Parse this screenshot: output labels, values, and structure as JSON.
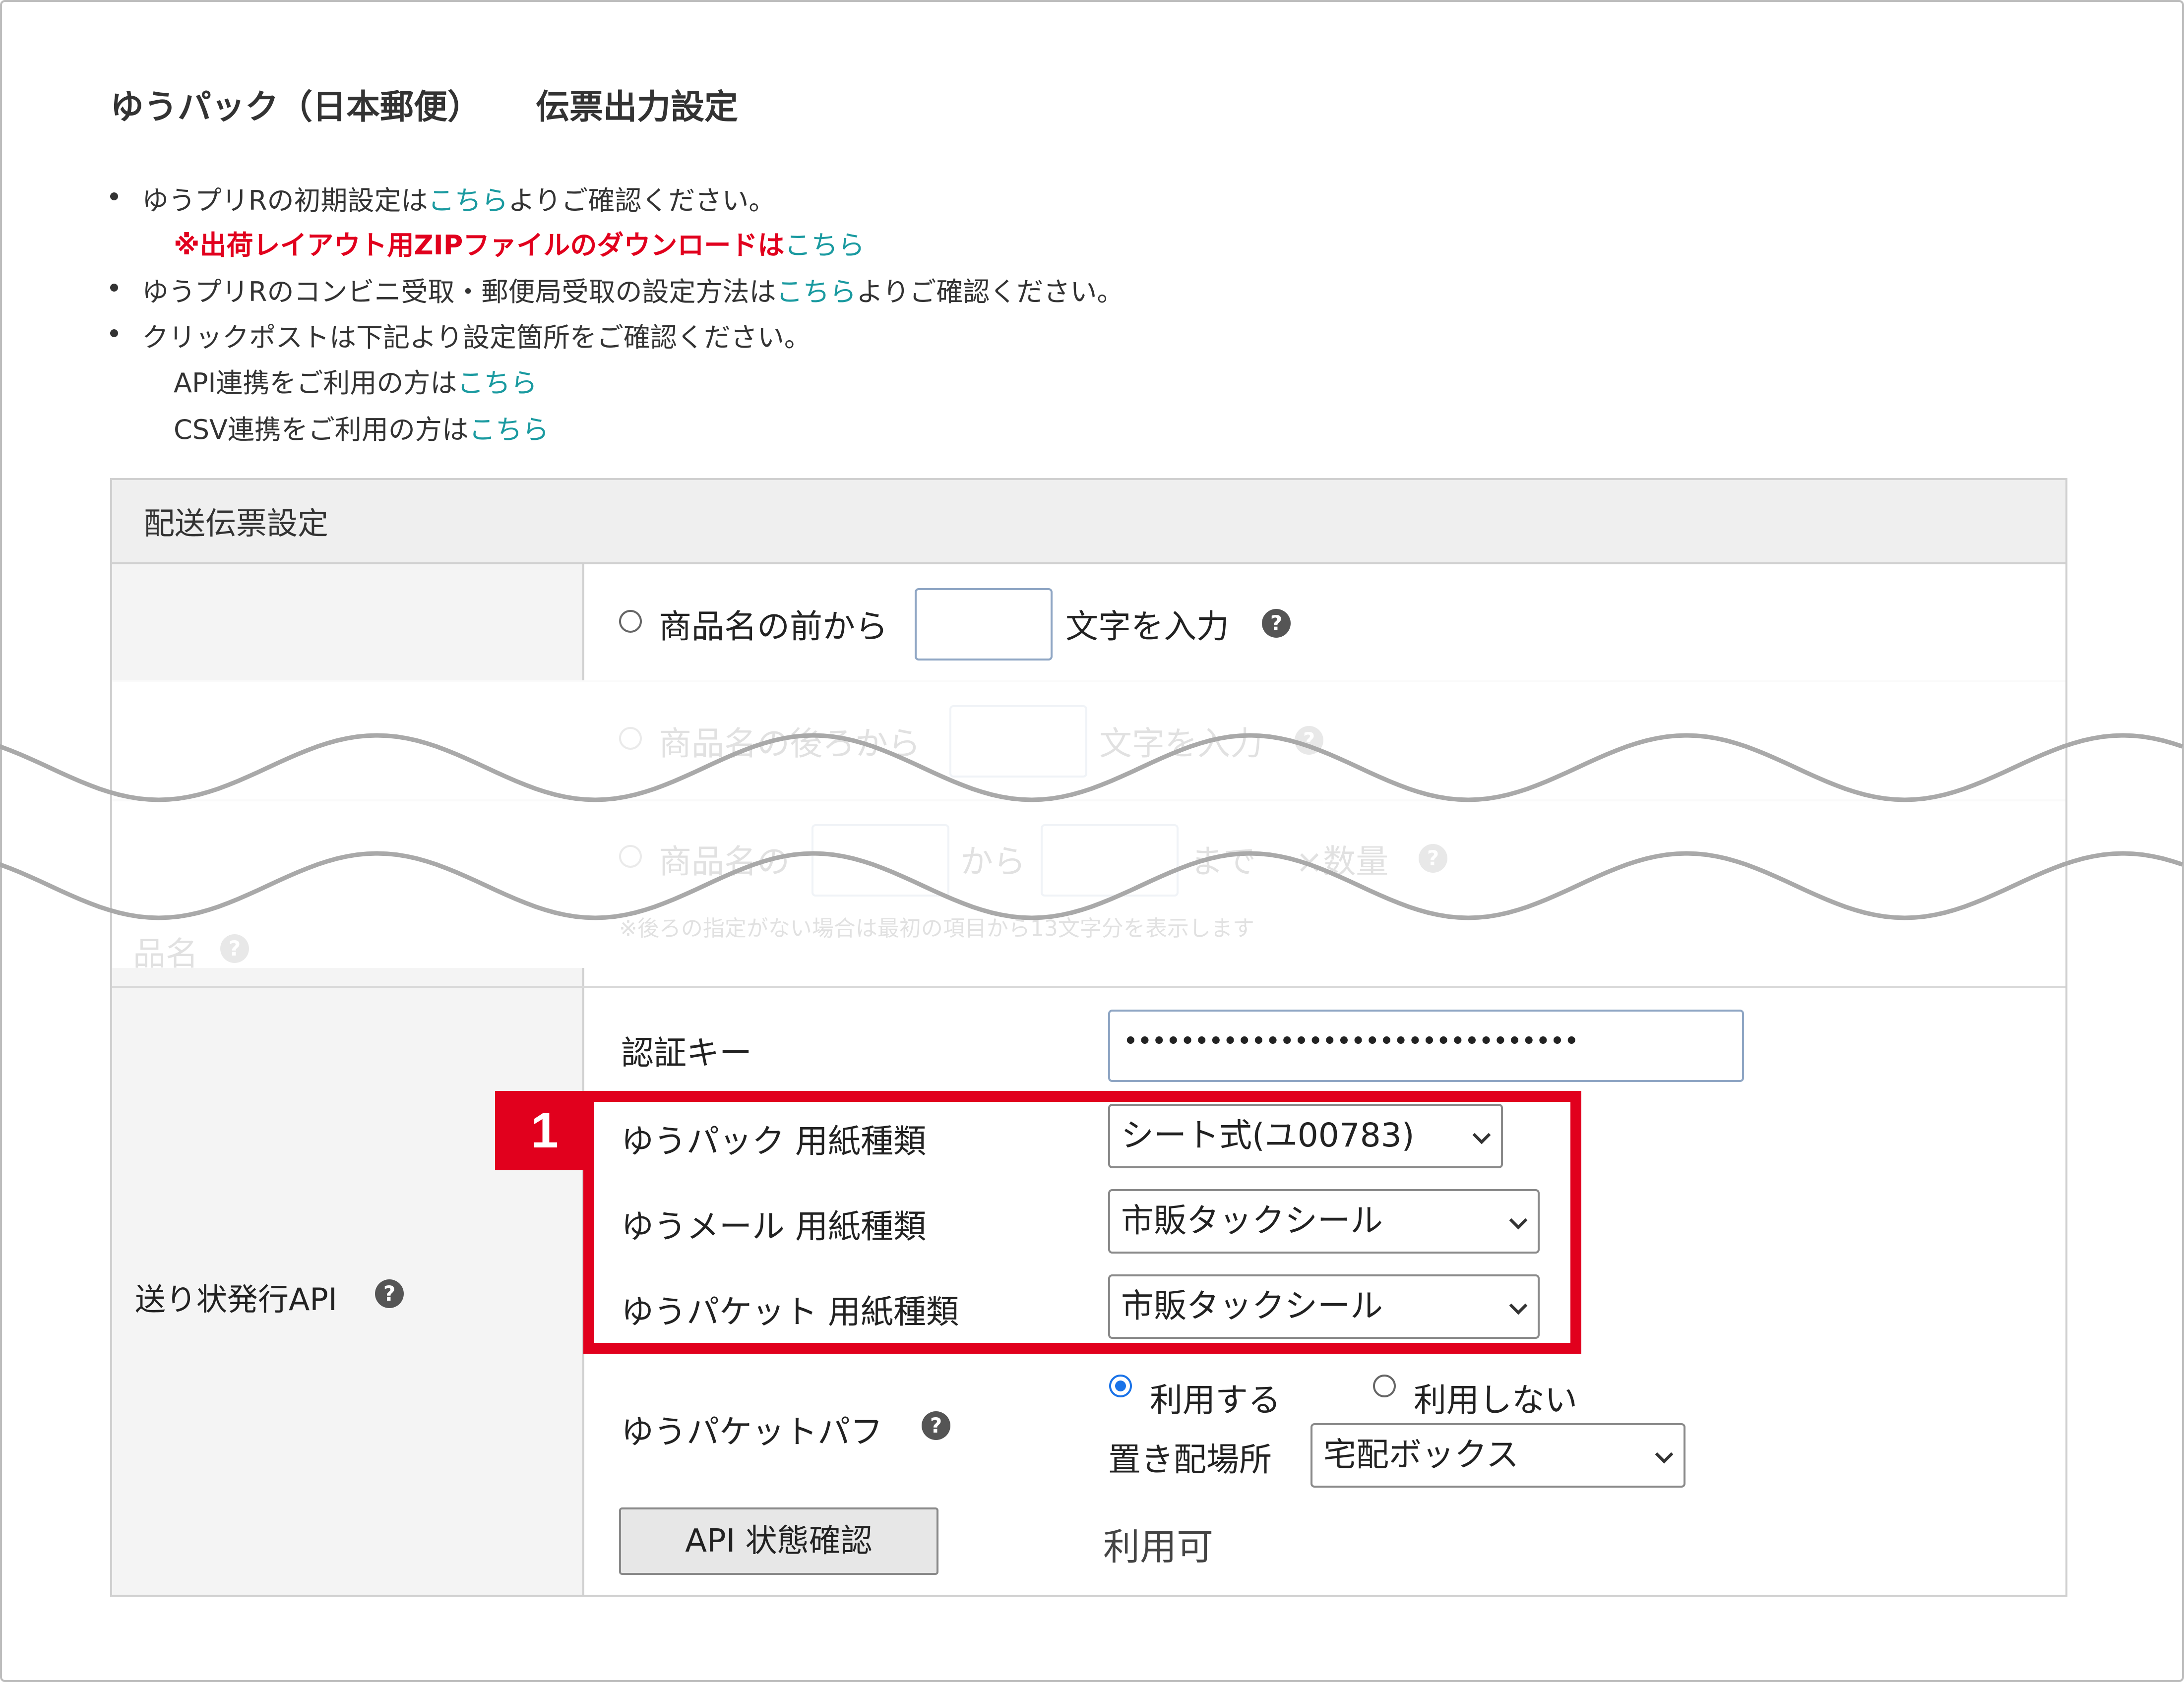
{
  "page": {
    "title_service": "ゆうパック（日本郵便）",
    "title_section": "伝票出力設定"
  },
  "info": {
    "line1_prefix": "ゆうプリRの初期設定は",
    "line1_link": "こちら",
    "line1_suffix": "よりご確認ください。",
    "zip_text": "※出荷レイアウト用ZIPファイルのダウンロードは",
    "zip_link": "こちら",
    "line2_prefix": "ゆうプリRのコンビニ受取・郵便局受取の設定方法は",
    "line2_link": "こちら",
    "line2_suffix": "よりご確認ください。",
    "line3": "クリックポストは下記より設定箇所をご確認ください。",
    "api_prefix": "API連携をご利用の方は",
    "api_link": "こちら",
    "csv_prefix": "CSV連携をご利用の方は",
    "csv_link": "こちら"
  },
  "table": {
    "header": "配送伝票設定",
    "product_name": {
      "label": "品名",
      "option1_prefix": "商品名の前から",
      "option1_suffix": "文字を入力",
      "option2_prefix": "商品名の後ろから",
      "option2_suffix": "文字を入力",
      "option3_prefix": "商品名の",
      "option3_middle": "から",
      "option3_suffix": "まで",
      "option3_tail": "×数量",
      "note": "※後ろの指定がない場合は最初の項目から13文字分を表示します"
    },
    "api": {
      "label": "送り状発行API",
      "auth_key_label": "認証キー",
      "auth_key_value": "••••••••••••••••••••••••••••••••",
      "yupack_paper_label": "ゆうパック 用紙種類",
      "yupack_paper_value": "シート式(ユ00783)",
      "yumail_paper_label": "ゆうメール 用紙種類",
      "yumail_paper_value": "市販タックシール",
      "yupacket_paper_label": "ゆうパケット 用紙種類",
      "yupacket_paper_value": "市販タックシール",
      "yupacket_puff_label": "ゆうパケットパフ",
      "use_label": "利用する",
      "not_use_label": "利用しない",
      "placement_label": "置き配場所",
      "placement_value": "宅配ボックス",
      "status_button": "API 状態確認",
      "status_value": "利用可"
    }
  },
  "annotation": {
    "badge": "1"
  },
  "colors": {
    "link": "#1a9aa0",
    "highlight_red": "#e1001d",
    "radio_blue": "#1a73e8"
  }
}
